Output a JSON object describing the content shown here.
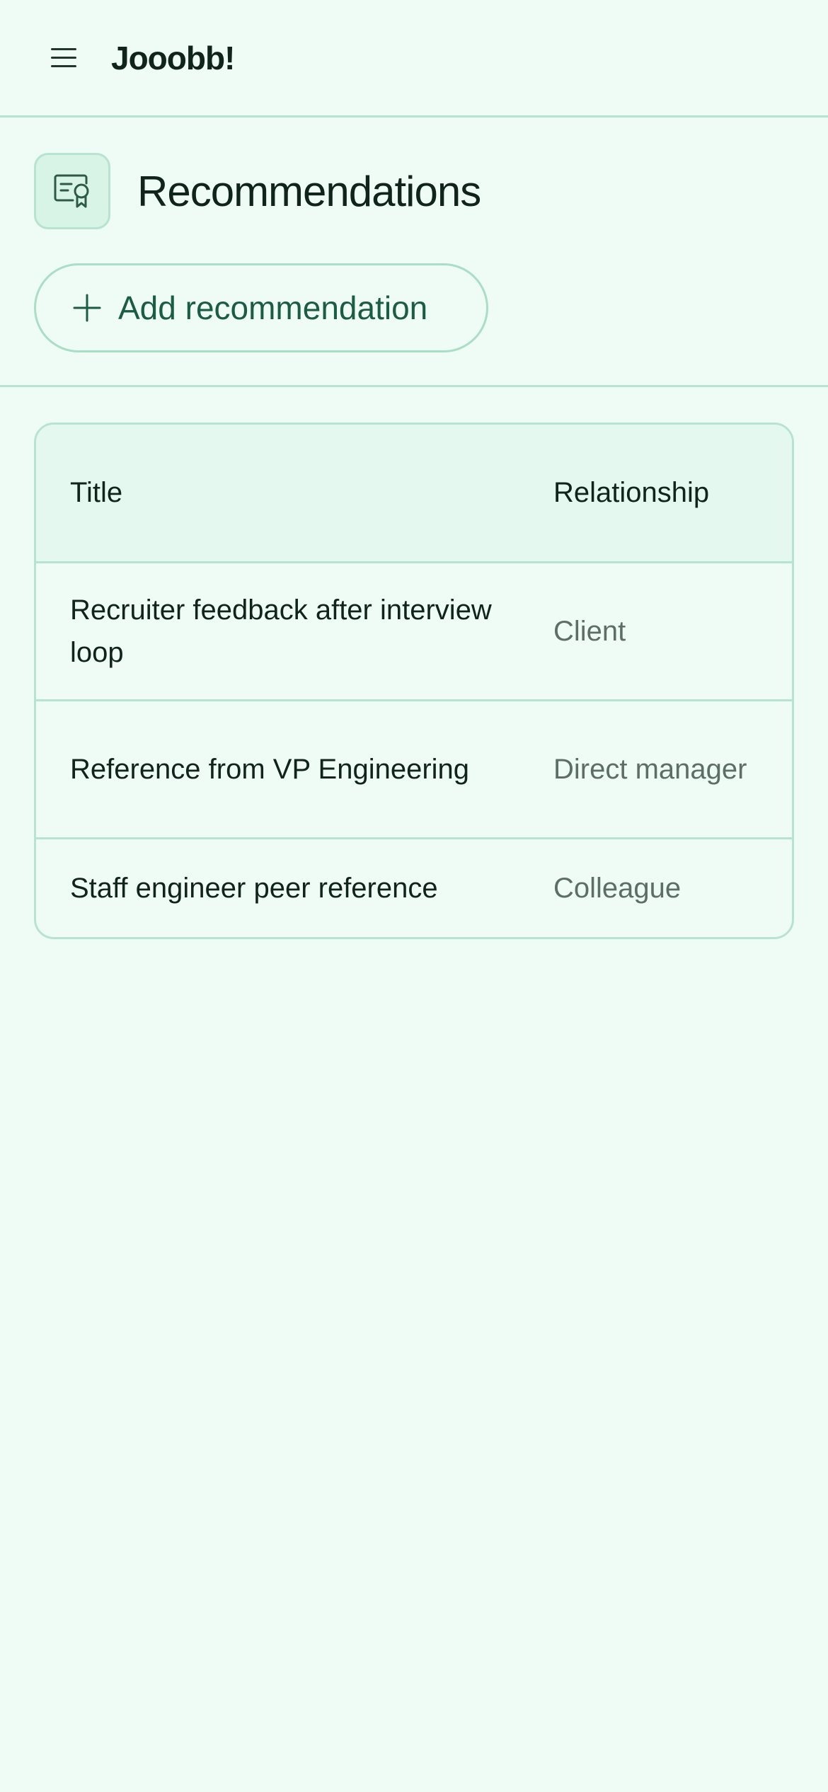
{
  "header": {
    "brand": "Jooobb!",
    "menu_icon": "hamburger-menu-icon"
  },
  "page": {
    "title": "Recommendations",
    "icon": "certificate-icon",
    "add_button_label": "Add recommendation"
  },
  "table": {
    "columns": [
      "Title",
      "Relationship"
    ],
    "rows": [
      {
        "title": "Recruiter feedback after interview loop",
        "relationship": "Client"
      },
      {
        "title": "Reference from VP Engineering",
        "relationship": "Direct manager"
      },
      {
        "title": "Staff engineer peer reference",
        "relationship": "Colleague"
      }
    ]
  },
  "colors": {
    "background": "#effbf5",
    "border": "#b7e4d0",
    "accent": "#1a5c44",
    "muted_text": "#5c6e66"
  }
}
